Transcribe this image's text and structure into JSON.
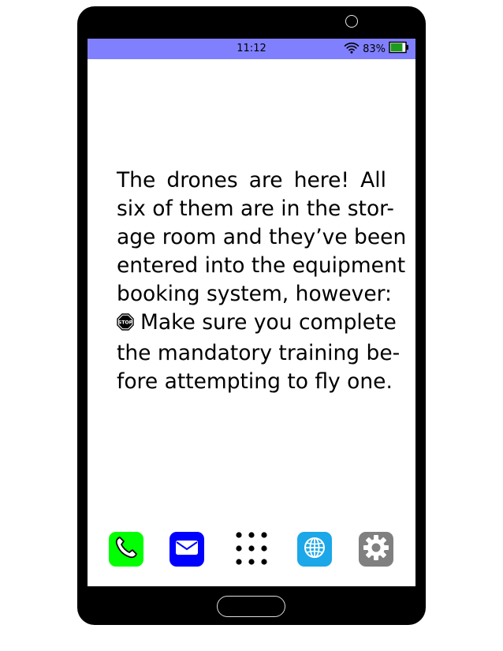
{
  "status_bar": {
    "time": "11:12",
    "battery_percent": "83%",
    "battery_level": 0.83,
    "color": "#8080ff",
    "wifi_icon": "wifi-icon",
    "battery_icon": "battery-icon"
  },
  "message": {
    "lines": [
      "The drones are here!  All",
      "six of them are in the stor-",
      "age room and they’ve been",
      "entered into the equipment",
      "booking system, however:",
      "Make sure you complete",
      "the mandatory training be-",
      "fore attempting to fly one."
    ],
    "inline_icon": "stop-sign-icon"
  },
  "dock": {
    "apps": [
      {
        "name": "phone",
        "icon": "phone-icon",
        "color": "#00ff00"
      },
      {
        "name": "mail",
        "icon": "mail-icon",
        "color": "#0000ff"
      },
      {
        "name": "app-drawer",
        "icon": "app-grid-icon",
        "color": "#000000"
      },
      {
        "name": "browser",
        "icon": "globe-icon",
        "color": "#1ca7e8"
      },
      {
        "name": "settings",
        "icon": "gear-icon",
        "color": "#808080"
      }
    ]
  }
}
